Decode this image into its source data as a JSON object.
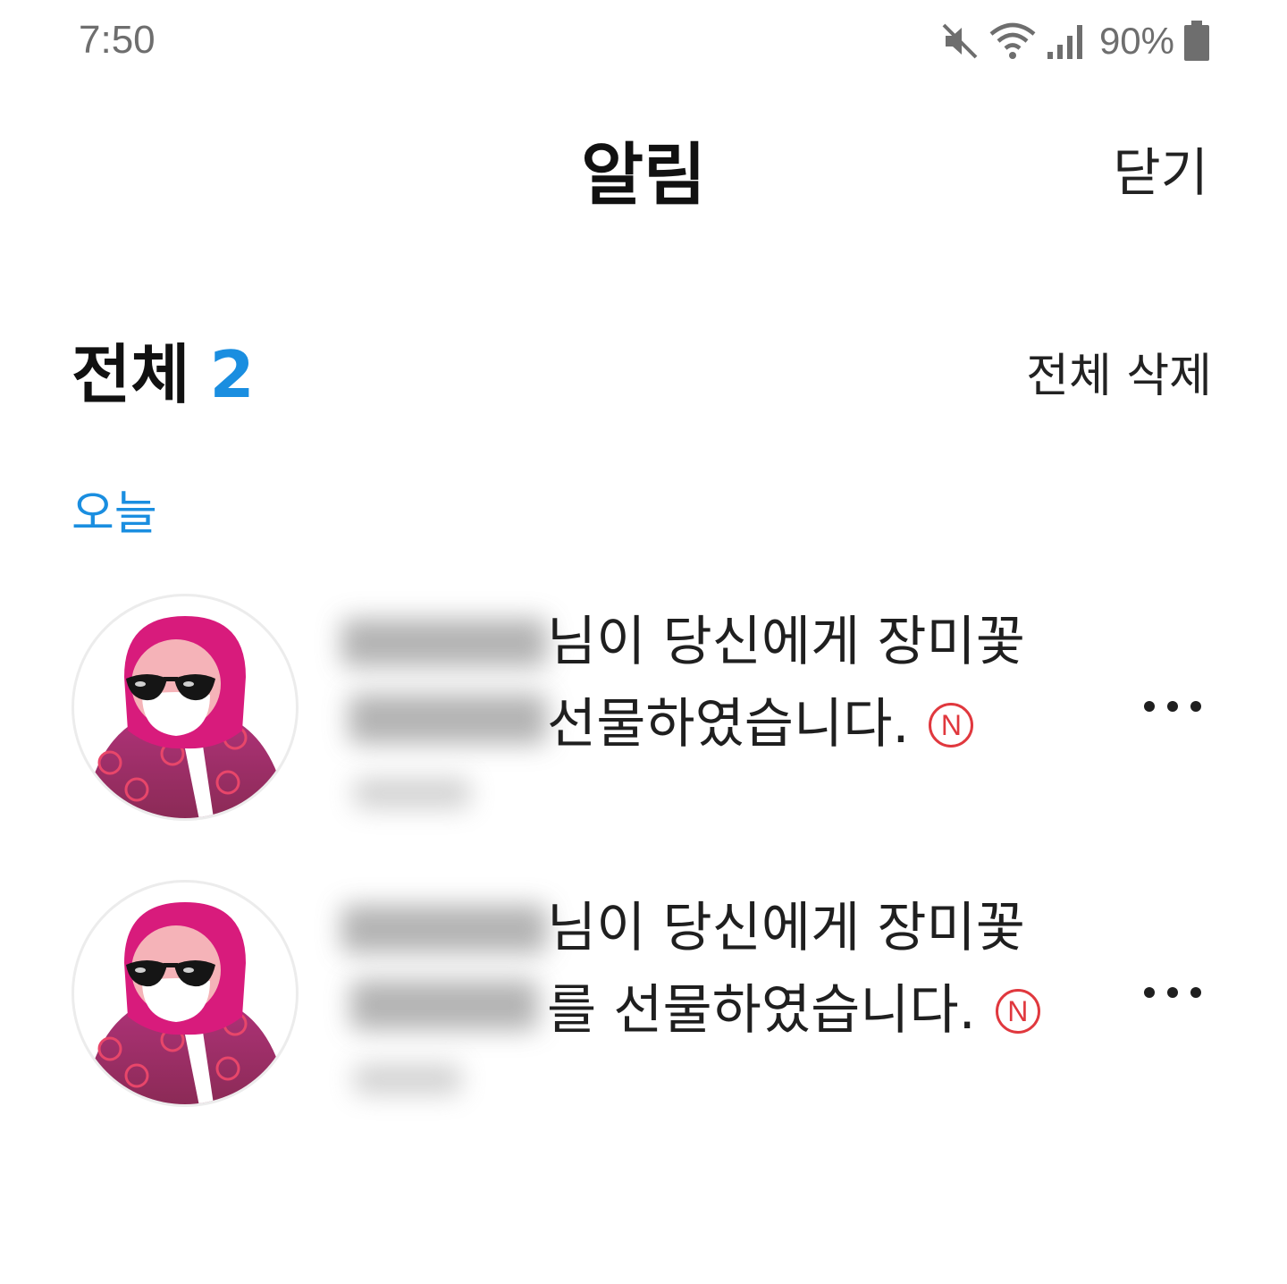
{
  "status_bar": {
    "time": "7:50",
    "battery_percent": "90%",
    "icons": [
      "mute-icon",
      "wifi-icon",
      "signal-icon",
      "battery-icon"
    ]
  },
  "header": {
    "title": "알림",
    "close_label": "닫기"
  },
  "section": {
    "title": "전체",
    "count": "2",
    "delete_all_label": "전체 삭제",
    "day_label": "오늘"
  },
  "notifications": [
    {
      "line1": "님이 당신에게 장미꽃",
      "line2": " 선물하였습니다.",
      "badge": "N"
    },
    {
      "line1": "님이 당신에게 장미꽃",
      "line2": "를 선물하였습니다.",
      "badge": "N"
    }
  ],
  "colors": {
    "accent": "#1a8ee0",
    "badge": "#e0383e",
    "avatar_pink": "#d81b7c",
    "avatar_purple": "#7b2a6e"
  }
}
